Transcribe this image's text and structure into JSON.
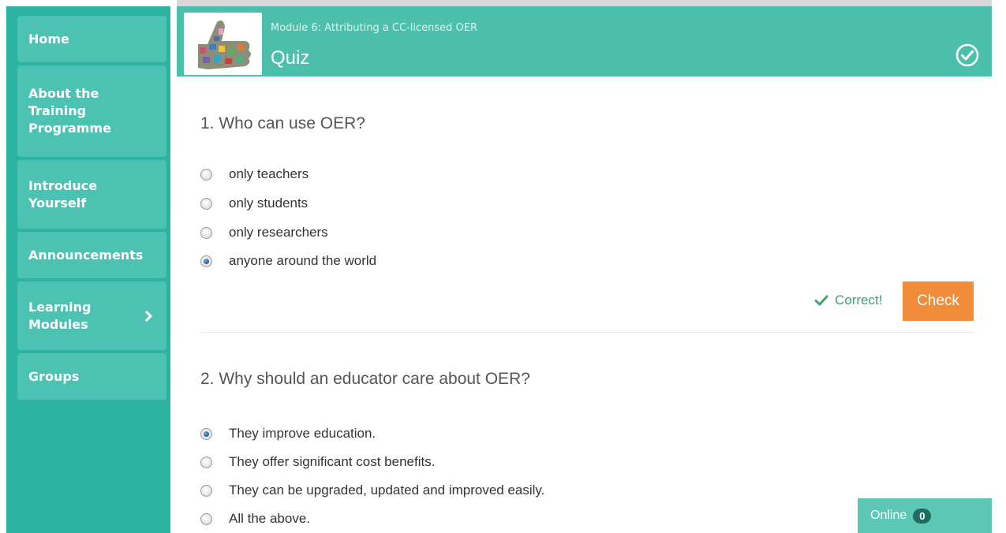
{
  "sidebar": {
    "items": [
      {
        "label": "Home"
      },
      {
        "label": "About the Training Programme"
      },
      {
        "label": "Introduce Yourself"
      },
      {
        "label": "Announcements"
      },
      {
        "label": "Learning Modules",
        "icon": "chevron-right-icon"
      },
      {
        "label": "Groups"
      }
    ]
  },
  "header": {
    "module_title": "Module 6: Attributing a CC-licensed OER",
    "page_title": "Quiz",
    "status_icon": "check-circle-icon"
  },
  "quiz": {
    "questions": [
      {
        "text": "1. Who can use OER?",
        "options": [
          "only teachers",
          "only students",
          "only researchers",
          "anyone around the world"
        ],
        "selected_index": 3,
        "feedback": "Correct!",
        "check_label": "Check"
      },
      {
        "text": "2. Why should an educator care about OER?",
        "options": [
          "They improve education.",
          "They offer significant cost benefits.",
          "They can be upgraded, updated and improved easily.",
          "All the above."
        ],
        "selected_index": 0
      }
    ]
  },
  "online": {
    "label": "Online",
    "count": "0"
  },
  "colors": {
    "sidebar_bg": "#2db3a2",
    "header_bg": "#4dbfad",
    "check_button": "#f08c3a",
    "correct": "#3aa66a"
  }
}
